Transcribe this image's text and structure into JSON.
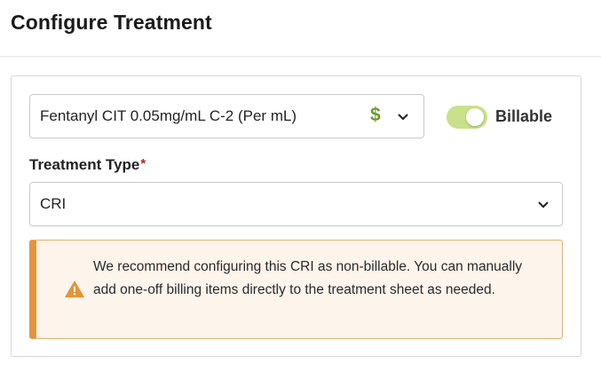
{
  "header": {
    "title": "Configure Treatment"
  },
  "product": {
    "selected": "Fentanyl CIT 0.05mg/mL C-2 (Per mL)",
    "billing_icon": "dollar-icon",
    "billing_icon_glyph": "$",
    "billing_icon_color": "#6b9a2f"
  },
  "billable_toggle": {
    "label": "Billable",
    "on": true,
    "track_color": "#c8e18a"
  },
  "treatment_type": {
    "label": "Treatment Type",
    "required_marker": "*",
    "selected": "CRI"
  },
  "alert": {
    "icon": "warning-icon",
    "message": "We recommend configuring this CRI as non-billable. You can manually add one-off billing items directly to the treatment sheet as needed.",
    "accent_color": "#e2953b",
    "background_color": "#fdf4ec"
  }
}
